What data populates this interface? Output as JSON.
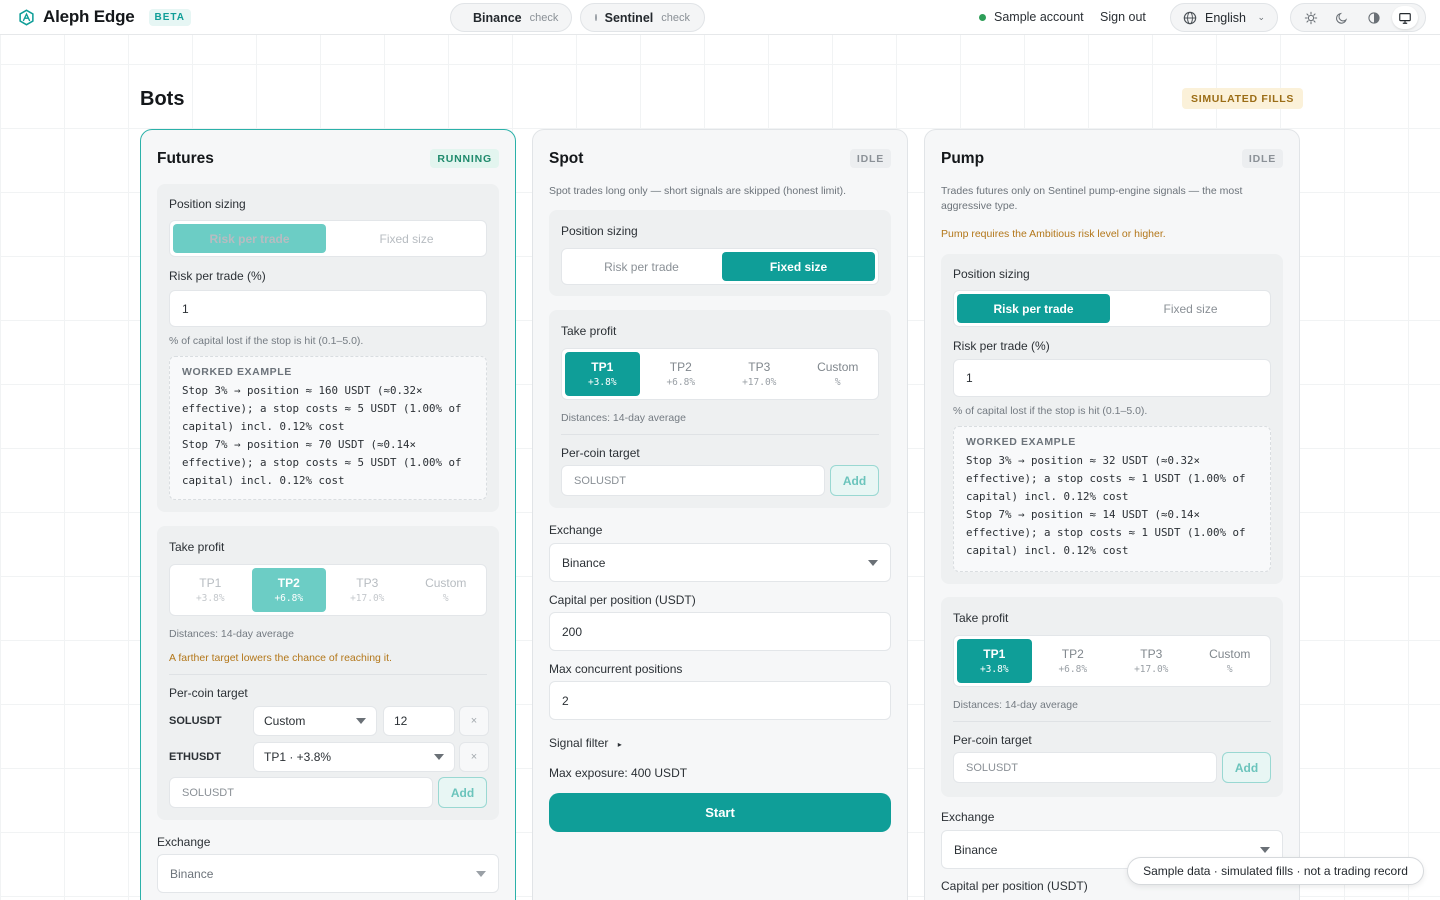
{
  "header": {
    "brand": "Aleph Edge",
    "beta": "BETA",
    "status": [
      {
        "name": "Binance",
        "state": "check"
      },
      {
        "name": "Sentinel",
        "state": "check"
      }
    ],
    "account": "Sample account",
    "sign_out": "Sign out",
    "language": "English",
    "theme_icons": [
      "sun-icon",
      "moon-icon",
      "contrast-icon",
      "monitor-icon"
    ],
    "active_theme": "monitor"
  },
  "page": {
    "title": "Bots",
    "mode_badge": "SIMULATED FILLS"
  },
  "colors": {
    "accent": "#0f9e98",
    "warning": "#b3771a",
    "running": "#1f8a6c"
  },
  "futures": {
    "title": "Futures",
    "status": "RUNNING",
    "sizing": {
      "label": "Position sizing",
      "options": [
        "Risk per trade",
        "Fixed size"
      ],
      "selected": "Risk per trade"
    },
    "risk_label": "Risk per trade (%)",
    "risk_value": "1",
    "risk_hint": "% of capital lost if the stop is hit (0.1–5.0).",
    "example": {
      "heading": "WORKED EXAMPLE",
      "line1": "Stop 3% → position ≈ 160 USDT (≈0.32× effective); a stop costs ≈ 5 USDT (1.00% of capital) incl. 0.12% cost",
      "line2": "Stop 7% → position ≈ 70 USDT (≈0.14× effective); a stop costs ≈ 5 USDT (1.00% of capital) incl. 0.12% cost"
    },
    "tp": {
      "label": "Take profit",
      "options": [
        {
          "name": "TP1",
          "value": "+3.8%"
        },
        {
          "name": "TP2",
          "value": "+6.8%"
        },
        {
          "name": "TP3",
          "value": "+17.0%"
        },
        {
          "name": "Custom",
          "value": "%"
        }
      ],
      "selected": "TP2",
      "distances": "Distances: 14-day average",
      "warning": "A farther target lowers the chance of reaching it."
    },
    "per_coin": {
      "label": "Per-coin target",
      "rows": [
        {
          "symbol": "SOLUSDT",
          "mode": "Custom",
          "value": "12"
        },
        {
          "symbol": "ETHUSDT",
          "mode": "TP1 · +3.8%"
        }
      ],
      "remove": "×",
      "placeholder": "SOLUSDT",
      "add": "Add"
    },
    "exchange_label": "Exchange",
    "exchange": "Binance"
  },
  "spot": {
    "title": "Spot",
    "status": "IDLE",
    "description": "Spot trades long only — short signals are skipped (honest limit).",
    "sizing": {
      "label": "Position sizing",
      "options": [
        "Risk per trade",
        "Fixed size"
      ],
      "selected": "Fixed size"
    },
    "tp": {
      "label": "Take profit",
      "options": [
        {
          "name": "TP1",
          "value": "+3.8%"
        },
        {
          "name": "TP2",
          "value": "+6.8%"
        },
        {
          "name": "TP3",
          "value": "+17.0%"
        },
        {
          "name": "Custom",
          "value": "%"
        }
      ],
      "selected": "TP1",
      "distances": "Distances: 14-day average"
    },
    "per_coin": {
      "label": "Per-coin target",
      "placeholder": "SOLUSDT",
      "add": "Add"
    },
    "exchange_label": "Exchange",
    "exchange": "Binance",
    "capital_label": "Capital per position (USDT)",
    "capital": "200",
    "max_label": "Max concurrent positions",
    "max": "2",
    "signal_filter": "Signal filter",
    "max_exposure": "Max exposure: 400 USDT",
    "start": "Start"
  },
  "pump": {
    "title": "Pump",
    "status": "IDLE",
    "description": "Trades futures only on Sentinel pump-engine signals — the most aggressive type.",
    "requirement": "Pump requires the Ambitious risk level or higher.",
    "sizing": {
      "label": "Position sizing",
      "options": [
        "Risk per trade",
        "Fixed size"
      ],
      "selected": "Risk per trade"
    },
    "risk_label": "Risk per trade (%)",
    "risk_value": "1",
    "risk_hint": "% of capital lost if the stop is hit (0.1–5.0).",
    "example": {
      "heading": "WORKED EXAMPLE",
      "line1": "Stop 3% → position ≈ 32 USDT (≈0.32× effective); a stop costs ≈ 1 USDT (1.00% of capital) incl. 0.12% cost",
      "line2": "Stop 7% → position ≈ 14 USDT (≈0.14× effective); a stop costs ≈ 1 USDT (1.00% of capital) incl. 0.12% cost"
    },
    "tp": {
      "label": "Take profit",
      "options": [
        {
          "name": "TP1",
          "value": "+3.8%"
        },
        {
          "name": "TP2",
          "value": "+6.8%"
        },
        {
          "name": "TP3",
          "value": "+17.0%"
        },
        {
          "name": "Custom",
          "value": "%"
        }
      ],
      "selected": "TP1",
      "distances": "Distances: 14-day average"
    },
    "per_coin": {
      "label": "Per-coin target",
      "placeholder": "SOLUSDT",
      "add": "Add"
    },
    "exchange_label": "Exchange",
    "exchange": "Binance",
    "capital_label": "Capital per position (USDT)"
  },
  "footer_toast": "Sample data · simulated fills · not a trading record"
}
